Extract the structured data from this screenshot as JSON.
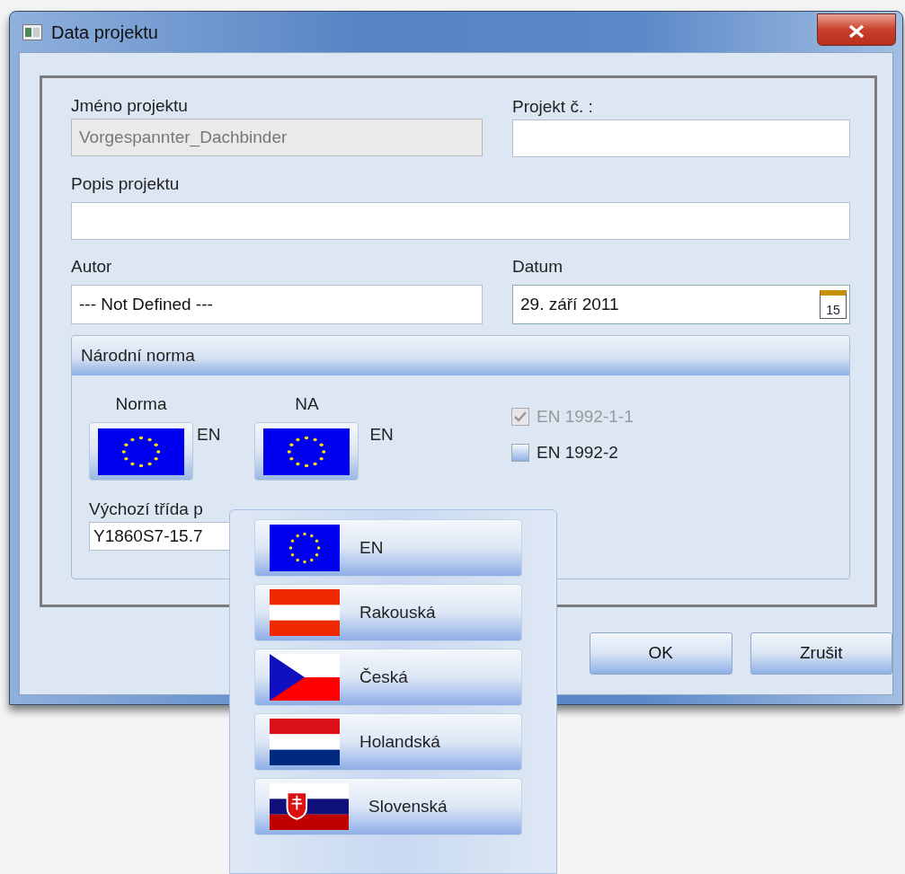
{
  "window": {
    "title": "Data projektu"
  },
  "project_name": {
    "label": "Jméno projektu",
    "value": "Vorgespannter_Dachbinder",
    "disabled": true
  },
  "project_number": {
    "label": "Projekt č. :"
  },
  "description": {
    "label": "Popis projektu"
  },
  "author": {
    "label": "Autor",
    "value": "--- Not Defined ---"
  },
  "date": {
    "label": "Datum",
    "value": "29. září 2011",
    "calendar_day": "15"
  },
  "national_standard": {
    "title": "Národní norma",
    "norma": {
      "label": "Norma",
      "kind": "eu",
      "code": "EN"
    },
    "na": {
      "label": "NA",
      "kind": "eu",
      "code": "EN"
    },
    "checkboxes": [
      {
        "label": "EN 1992-1-1",
        "checked": true,
        "disabled": true
      },
      {
        "label": "EN 1992-2",
        "checked": false,
        "disabled": false
      }
    ],
    "default_class": {
      "label": "Výchozí třída p",
      "value": "Y1860S7-15.7"
    }
  },
  "buttons": [
    {
      "label": "OK"
    },
    {
      "label": "Zrušit"
    }
  ],
  "dropdown": {
    "items": [
      {
        "label": "EN",
        "kind": "eu"
      },
      {
        "label": "Rakouská",
        "kind": "at"
      },
      {
        "label": "Česká",
        "kind": "cz"
      },
      {
        "label": "Holandská",
        "kind": "nl"
      },
      {
        "label": "Slovenská",
        "kind": "sk"
      }
    ]
  }
}
